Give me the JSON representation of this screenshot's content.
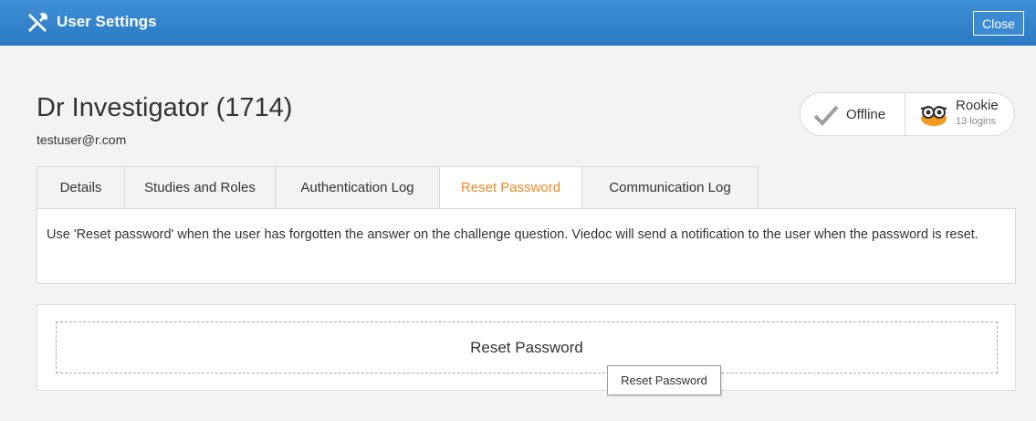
{
  "window": {
    "title": "User Settings",
    "close_label": "Close",
    "icon": "tools-icon"
  },
  "user": {
    "name": "Dr Investigator (1714)",
    "email": "testuser@r.com"
  },
  "status": {
    "presence": "Offline",
    "presence_icon": "checkmark-icon",
    "rank": "Rookie",
    "logins": "13 logins",
    "rank_icon": "owl-icon"
  },
  "tabs": [
    {
      "label": "Details",
      "active": false
    },
    {
      "label": "Studies and Roles",
      "active": false
    },
    {
      "label": "Authentication Log",
      "active": false
    },
    {
      "label": "Reset Password",
      "active": true
    },
    {
      "label": "Communication Log",
      "active": false
    }
  ],
  "panel": {
    "description": "Use 'Reset password' when the user has forgotten the answer on the challenge question. Viedoc will send a notification to the user when the password is reset."
  },
  "reset": {
    "button_label": "Reset Password",
    "tooltip": "Reset Password"
  },
  "colors": {
    "titlebar": "#2f82cc",
    "active_tab": "#f08a24"
  }
}
